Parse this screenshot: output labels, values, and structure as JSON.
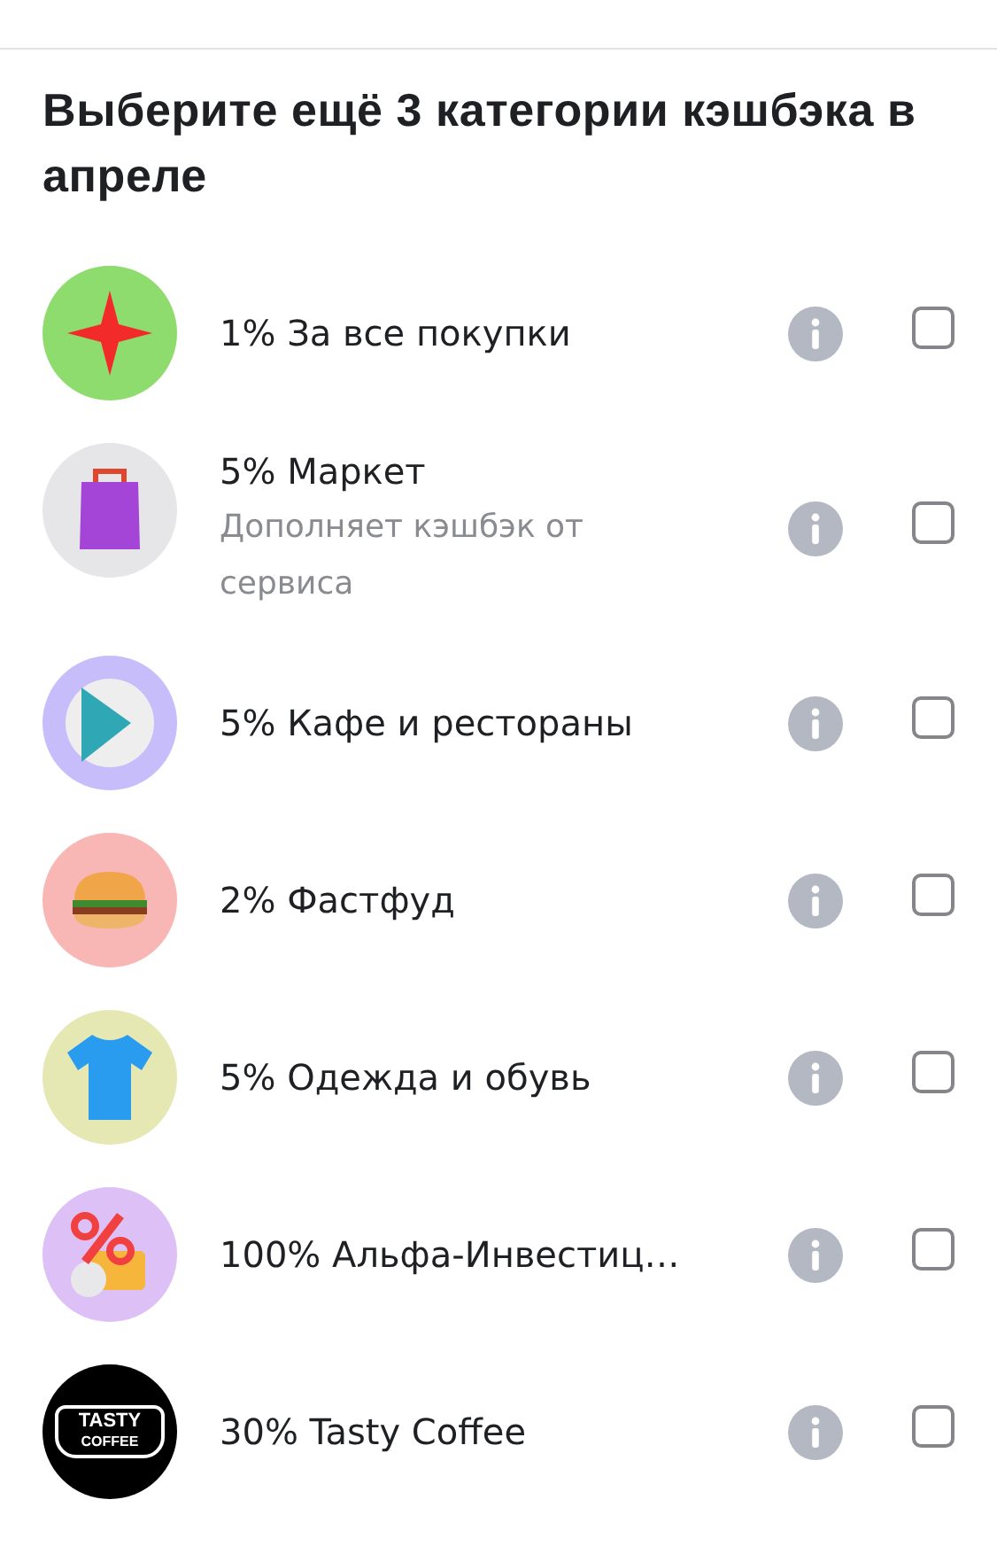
{
  "title": "Выберите ещё 3 категории кэшбэка в апреле",
  "categories": [
    {
      "kind": "star",
      "color": "#8fdc6e",
      "label": "1% За все покупки",
      "checked": false
    },
    {
      "kind": "bag",
      "color": "#e6e6e8",
      "label": "5% Маркет",
      "note": "Дополняет кэшбэк от сервиса",
      "checked": false
    },
    {
      "kind": "plate",
      "color": "#c7bdfa",
      "label": "5% Кафе и рестораны",
      "checked": false
    },
    {
      "kind": "burger",
      "color": "#f8b6b4",
      "label": "2% Фастфуд",
      "checked": false
    },
    {
      "kind": "shirt",
      "color": "#e6e8b4",
      "label": "5% Одежда и обувь",
      "checked": false
    },
    {
      "kind": "percent",
      "color": "#dcc0f6",
      "label": "100% Альфа-Инвестиц…",
      "checked": false
    },
    {
      "kind": "logo",
      "color": "#000000",
      "logo_lines": [
        "TASTY",
        "COFFEE"
      ],
      "label": "30% Tasty Coffee",
      "checked": false
    }
  ]
}
